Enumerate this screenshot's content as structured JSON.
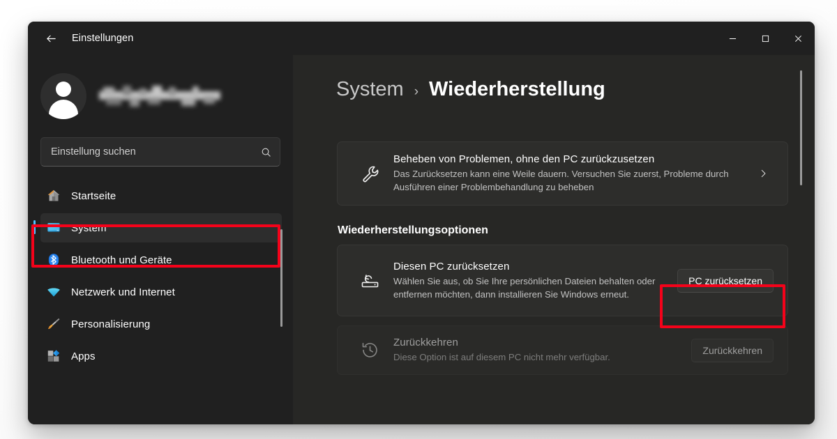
{
  "window": {
    "app_title": "Einstellungen",
    "back_label": "Zurück",
    "controls": {
      "minimize": "Minimieren",
      "maximize": "Maximieren",
      "close": "Schließen"
    }
  },
  "sidebar": {
    "account": {
      "name_redacted": true
    },
    "search": {
      "placeholder": "Einstellung suchen"
    },
    "items": [
      {
        "label": "Startseite",
        "icon": "home-icon",
        "selected": false
      },
      {
        "label": "System",
        "icon": "monitor-icon",
        "selected": true
      },
      {
        "label": "Bluetooth und Geräte",
        "icon": "bluetooth-icon",
        "selected": false
      },
      {
        "label": "Netzwerk und Internet",
        "icon": "wifi-icon",
        "selected": false
      },
      {
        "label": "Personalisierung",
        "icon": "paintbrush-icon",
        "selected": false
      },
      {
        "label": "Apps",
        "icon": "apps-icon",
        "selected": false
      }
    ]
  },
  "main": {
    "breadcrumb": {
      "parent": "System",
      "separator": "›",
      "current": "Wiederherstellung"
    },
    "troubleshoot_card": {
      "title": "Beheben von Problemen, ohne den PC zurückzusetzen",
      "subtitle": "Das Zurücksetzen kann eine Weile dauern. Versuchen Sie zuerst, Probleme durch Ausführen einer Problembehandlung zu beheben",
      "icon": "wrench-icon",
      "chevron": "chevron-right-icon"
    },
    "section_title": "Wiederherstellungsoptionen",
    "reset_card": {
      "title": "Diesen PC zurücksetzen",
      "subtitle": "Wählen Sie aus, ob Sie Ihre persönlichen Dateien behalten oder entfernen möchten, dann installieren Sie Windows erneut.",
      "icon": "reset-pc-icon",
      "button_label": "PC zurücksetzen"
    },
    "goback_card": {
      "title": "Zurückkehren",
      "subtitle": "Diese Option ist auf diesem PC nicht mehr verfügbar.",
      "icon": "history-rewind-icon",
      "button_label": "Zurückkehren",
      "disabled": true
    }
  },
  "annotations": {
    "highlight_color": "#f4021a",
    "boxes": [
      {
        "target": "sidebar-item-system"
      },
      {
        "target": "reset-pc-button"
      }
    ]
  },
  "theme": {
    "accent": "#4cc2ff",
    "window_bg": "#202020",
    "content_bg": "#272725",
    "card_bg": "#2d2d2b"
  }
}
